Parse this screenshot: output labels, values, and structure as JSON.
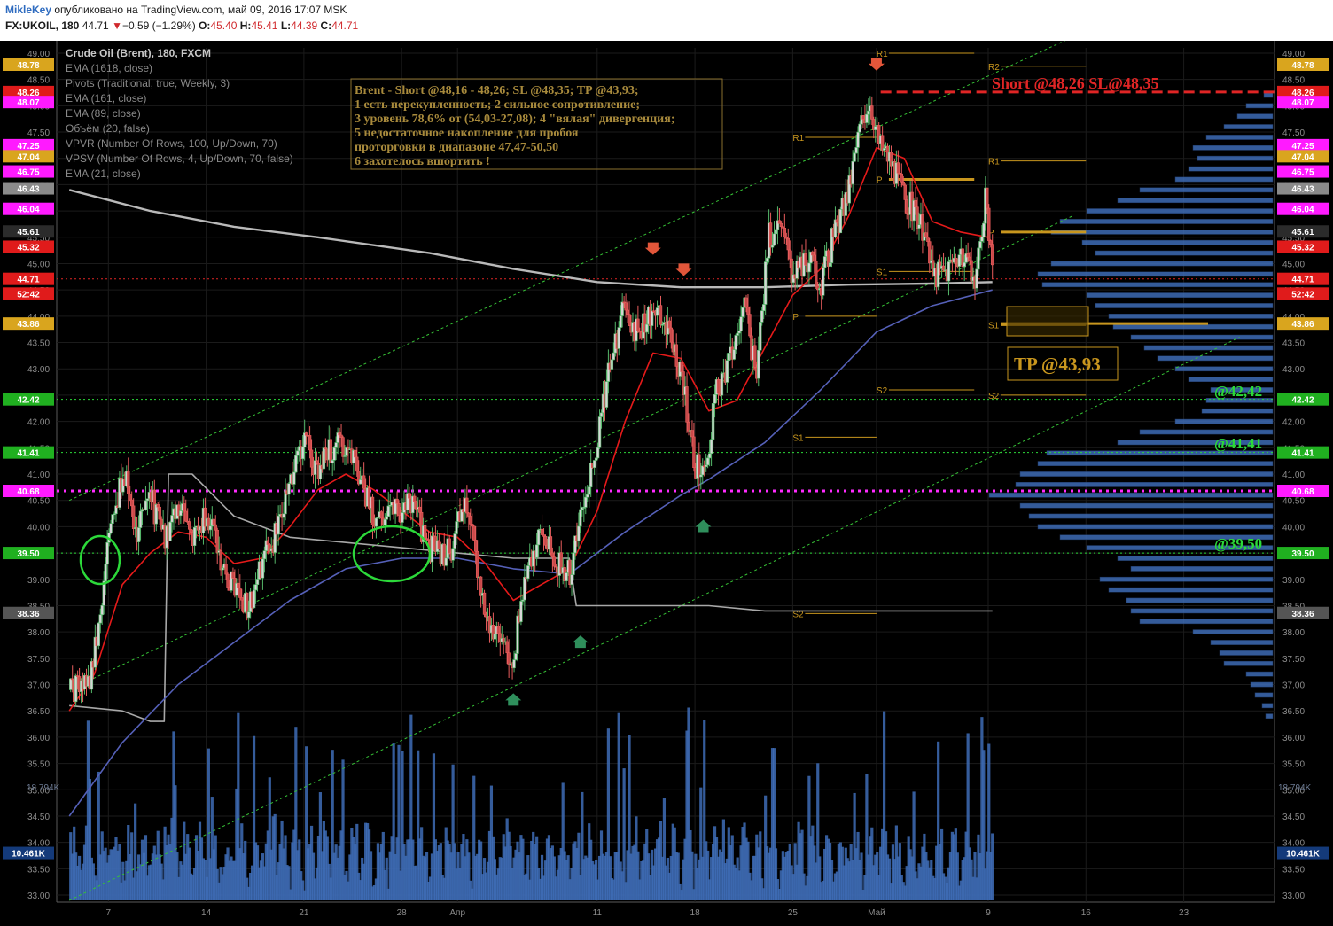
{
  "header": {
    "user": "MikleKey",
    "published": "опубликовано на TradingView.com, май 09, 2016 17:07 MSK",
    "symbol": "FX:UKOIL, 180",
    "last": "44.71",
    "arrow": "▼",
    "change": "−0.59 (−1.29%)",
    "o_label": "O:",
    "o": "45.40",
    "h_label": "H:",
    "h": "45.41",
    "l_label": "L:",
    "l": "44.39",
    "c_label": "C:",
    "c": "44.71"
  },
  "colors": {
    "bg": "#000000",
    "grid": "#1b1b1b",
    "axis_text": "#8c8c8c",
    "up": "#55b86a",
    "down": "#e85d5d",
    "ema21": "#e51a1a",
    "ema89": "#5560b8",
    "ema161": "#a8a8a8",
    "pivot": "#c8961e",
    "magenta": "#ff2bff",
    "green_note": "#2cd93a",
    "volume": "#3e6cb6",
    "note": "#a88a3c",
    "short": "#e02525"
  },
  "legend": [
    "Crude Oil (Brent), 180, FXCM",
    "EMA (1618, close)",
    "Pivots (Traditional, true, Weekly, 3)",
    "EMA (161, close)",
    "EMA (89, close)",
    "Объём (20, false)",
    "VPVR (Number Of Rows, 100, Up/Down, 70)",
    "VPSV (Number Of Rows, 4, Up/Down, 70, false)",
    "EMA (21, close)"
  ],
  "note": {
    "lines": [
      "Brent - Short @48,16 - 48,26; SL @48,35; TP @43,93;",
      "1 есть перекупленность; 2 сильное сопротивление;",
      "3 уровень 78,6% от (54,03-27,08); 4 \"вялая\" дивергенция;",
      "5 недостаточное накопление для пробоя",
      "проторговки в диапазоне 47,47-50,50",
      "6 захотелось вшортить !"
    ]
  },
  "annotations": {
    "short": "Short @48,26 SL@48,35",
    "tp": "TP @43,93",
    "lvl1": "@42,42",
    "lvl2": "@41,41",
    "lvl3": "@39,50"
  },
  "chart_data": {
    "type": "candlestick",
    "symbol": "FX:UKOIL",
    "title": "Crude Oil (Brent), 180, FXCM",
    "ylim": [
      32.9,
      49.1
    ],
    "y_ticks": [
      "49.00",
      "48.50",
      "48.00",
      "47.50",
      "47.00",
      "46.50",
      "46.00",
      "45.50",
      "45.00",
      "44.50",
      "44.00",
      "43.50",
      "43.00",
      "42.50",
      "42.00",
      "41.50",
      "41.00",
      "40.50",
      "40.00",
      "39.50",
      "39.00",
      "38.50",
      "38.00",
      "37.50",
      "37.00",
      "36.50",
      "36.00",
      "35.50",
      "35.00",
      "34.50",
      "34.00",
      "33.50",
      "33.00"
    ],
    "x_ticks": [
      {
        "label": "7",
        "day": 7
      },
      {
        "label": "14",
        "day": 14
      },
      {
        "label": "21",
        "day": 21
      },
      {
        "label": "28",
        "day": 28
      },
      {
        "label": "Апр",
        "day": 32
      },
      {
        "label": "11",
        "day": 42
      },
      {
        "label": "18",
        "day": 49
      },
      {
        "label": "25",
        "day": 56
      },
      {
        "label": "Май",
        "day": 62
      },
      {
        "label": "9",
        "day": 70
      },
      {
        "label": "16",
        "day": 77
      },
      {
        "label": "23",
        "day": 84
      }
    ],
    "price_path": [
      [
        4.2,
        36.9
      ],
      [
        5.5,
        36.9
      ],
      [
        6.5,
        38.4
      ],
      [
        7.2,
        40.4
      ],
      [
        8.3,
        40.9
      ],
      [
        9.0,
        39.8
      ],
      [
        10.0,
        40.6
      ],
      [
        11.0,
        39.7
      ],
      [
        12.0,
        40.3
      ],
      [
        13.0,
        39.9
      ],
      [
        14.2,
        40.2
      ],
      [
        15.0,
        39.4
      ],
      [
        16.0,
        38.8
      ],
      [
        17.0,
        38.4
      ],
      [
        18.0,
        39.3
      ],
      [
        19.0,
        39.9
      ],
      [
        20.0,
        40.7
      ],
      [
        21.0,
        41.7
      ],
      [
        21.8,
        41.1
      ],
      [
        22.8,
        41.4
      ],
      [
        23.8,
        41.6
      ],
      [
        24.8,
        41.2
      ],
      [
        25.8,
        40.3
      ],
      [
        26.8,
        40.1
      ],
      [
        27.8,
        40.3
      ],
      [
        28.8,
        40.5
      ],
      [
        29.8,
        39.6
      ],
      [
        30.8,
        39.5
      ],
      [
        31.8,
        39.6
      ],
      [
        32.3,
        40.6
      ],
      [
        33.0,
        39.9
      ],
      [
        34.0,
        38.4
      ],
      [
        35.0,
        37.7
      ],
      [
        36.0,
        37.5
      ],
      [
        37.0,
        39.3
      ],
      [
        38.0,
        40.0
      ],
      [
        39.0,
        39.3
      ],
      [
        40.0,
        39.1
      ],
      [
        41.0,
        40.3
      ],
      [
        42.0,
        41.6
      ],
      [
        43.0,
        43.2
      ],
      [
        44.0,
        44.2
      ],
      [
        45.0,
        43.6
      ],
      [
        46.0,
        44.2
      ],
      [
        47.0,
        43.7
      ],
      [
        48.0,
        42.9
      ],
      [
        49.0,
        41.2
      ],
      [
        49.8,
        40.9
      ],
      [
        50.4,
        42.5
      ],
      [
        51.5,
        43.2
      ],
      [
        52.5,
        44.2
      ],
      [
        53.4,
        42.9
      ],
      [
        54.3,
        45.5
      ],
      [
        55.2,
        45.9
      ],
      [
        56.0,
        44.7
      ],
      [
        57.0,
        45.1
      ],
      [
        58.0,
        44.6
      ],
      [
        59.0,
        45.6
      ],
      [
        60.0,
        46.4
      ],
      [
        60.8,
        47.6
      ],
      [
        61.5,
        48.2
      ],
      [
        62.2,
        47.3
      ],
      [
        63.0,
        47.0
      ],
      [
        64.0,
        46.3
      ],
      [
        65.0,
        45.9
      ],
      [
        66.0,
        44.8
      ],
      [
        67.0,
        44.9
      ],
      [
        68.0,
        45.3
      ],
      [
        69.0,
        44.6
      ],
      [
        69.8,
        46.2
      ],
      [
        70.3,
        44.8
      ]
    ],
    "ema21": [
      [
        4.2,
        36.5
      ],
      [
        6.0,
        37.2
      ],
      [
        8.0,
        38.9
      ],
      [
        10.0,
        39.5
      ],
      [
        12.0,
        39.9
      ],
      [
        14.0,
        39.8
      ],
      [
        16.0,
        39.3
      ],
      [
        18.0,
        39.4
      ],
      [
        20.0,
        40.0
      ],
      [
        22.0,
        40.7
      ],
      [
        24.0,
        41.0
      ],
      [
        26.0,
        40.7
      ],
      [
        28.0,
        40.3
      ],
      [
        30.0,
        39.9
      ],
      [
        32.0,
        39.8
      ],
      [
        34.0,
        39.3
      ],
      [
        36.0,
        38.6
      ],
      [
        38.0,
        38.9
      ],
      [
        40.0,
        39.2
      ],
      [
        42.0,
        40.3
      ],
      [
        44.0,
        42.0
      ],
      [
        46.0,
        43.3
      ],
      [
        48.0,
        43.2
      ],
      [
        50.0,
        42.2
      ],
      [
        52.0,
        42.4
      ],
      [
        54.0,
        43.4
      ],
      [
        56.0,
        44.4
      ],
      [
        58.0,
        44.9
      ],
      [
        60.0,
        45.9
      ],
      [
        62.0,
        47.2
      ],
      [
        64.0,
        47.0
      ],
      [
        66.0,
        45.8
      ],
      [
        68.0,
        45.6
      ],
      [
        70.0,
        45.5
      ],
      [
        70.3,
        45.4
      ]
    ],
    "ema89": [
      [
        4.2,
        34.5
      ],
      [
        8.0,
        35.9
      ],
      [
        12.0,
        37.0
      ],
      [
        16.0,
        37.8
      ],
      [
        20.0,
        38.6
      ],
      [
        24.0,
        39.2
      ],
      [
        28.0,
        39.4
      ],
      [
        32.0,
        39.4
      ],
      [
        36.0,
        39.2
      ],
      [
        40.0,
        39.1
      ],
      [
        44.0,
        39.9
      ],
      [
        48.0,
        40.6
      ],
      [
        50.0,
        40.9
      ],
      [
        54.0,
        41.6
      ],
      [
        58.0,
        42.6
      ],
      [
        62.0,
        43.7
      ],
      [
        66.0,
        44.2
      ],
      [
        70.3,
        44.5
      ]
    ],
    "ema1618": [
      [
        4.2,
        46.4
      ],
      [
        10.0,
        46.0
      ],
      [
        16.0,
        45.7
      ],
      [
        22.0,
        45.5
      ],
      [
        30.0,
        45.2
      ],
      [
        36.0,
        44.9
      ],
      [
        42.0,
        44.65
      ],
      [
        48.0,
        44.55
      ],
      [
        54.0,
        44.55
      ],
      [
        60.0,
        44.6
      ],
      [
        66.0,
        44.62
      ],
      [
        70.3,
        44.65
      ]
    ],
    "ema161": [
      [
        4.2,
        36.6
      ],
      [
        8.0,
        36.5
      ],
      [
        10.0,
        36.3
      ],
      [
        11.0,
        36.3
      ],
      [
        11.3,
        41.0
      ],
      [
        13.0,
        41.0
      ],
      [
        16.0,
        40.2
      ],
      [
        20.0,
        39.8
      ],
      [
        24.0,
        39.7
      ],
      [
        28.0,
        39.6
      ],
      [
        32.0,
        39.5
      ],
      [
        36.0,
        39.4
      ],
      [
        40.0,
        39.4
      ],
      [
        40.5,
        38.5
      ],
      [
        46.0,
        38.5
      ],
      [
        50.0,
        38.5
      ],
      [
        54.0,
        38.4
      ],
      [
        58.0,
        38.4
      ],
      [
        62.0,
        38.4
      ],
      [
        66.0,
        38.4
      ],
      [
        70.3,
        38.4
      ]
    ],
    "pivots": [
      {
        "label": "R1",
        "start": 62,
        "end": 69,
        "price": 49.0
      },
      {
        "label": "R2",
        "start": 70,
        "end": 77,
        "price": 48.75
      },
      {
        "label": "R1",
        "start": 56,
        "end": 62,
        "price": 47.4
      },
      {
        "label": "R1",
        "start": 70,
        "end": 77,
        "price": 46.95
      },
      {
        "label": "P",
        "start": 62,
        "end": 69,
        "price": 46.6
      },
      {
        "label": "P",
        "start": 70,
        "end": 77,
        "price": 45.6
      },
      {
        "label": "S1",
        "start": 62,
        "end": 69,
        "price": 44.85
      },
      {
        "label": "P",
        "start": 56,
        "end": 62,
        "price": 44.0
      },
      {
        "label": "S1",
        "start": 70,
        "end": 77,
        "price": 43.84
      },
      {
        "label": "S2",
        "start": 62,
        "end": 69,
        "price": 42.6
      },
      {
        "label": "S2",
        "start": 70,
        "end": 77,
        "price": 42.5
      },
      {
        "label": "S1",
        "start": 56,
        "end": 62,
        "price": 41.7
      },
      {
        "label": "S2",
        "start": 56,
        "end": 62,
        "price": 38.35
      }
    ],
    "price_labels": [
      {
        "price": 48.78,
        "text": "48.78",
        "color": "#d9a51e"
      },
      {
        "price": 48.26,
        "text": "48.26",
        "color": "#e01b1b"
      },
      {
        "price": 48.07,
        "text": "48.07",
        "color": "#ff1aff"
      },
      {
        "price": 47.25,
        "text": "47.25",
        "color": "#ff1aff"
      },
      {
        "price": 47.04,
        "text": "47.04",
        "color": "#d9a51e"
      },
      {
        "price": 46.75,
        "text": "46.75",
        "color": "#ff1aff"
      },
      {
        "price": 46.43,
        "text": "46.43",
        "color": "#8a8a8a"
      },
      {
        "price": 46.04,
        "text": "46.04",
        "color": "#ff1aff"
      },
      {
        "price": 45.61,
        "text": "45.61",
        "color": "#2b2b2b"
      },
      {
        "price": 45.32,
        "text": "45.32",
        "color": "#e01b1b"
      },
      {
        "price": 44.71,
        "text": "44.71",
        "color": "#e01b1b"
      },
      {
        "price": 44.43,
        "text": "52:42",
        "color": "#e01b1b"
      },
      {
        "price": 43.86,
        "text": "43.86",
        "color": "#d9a51e"
      },
      {
        "price": 42.42,
        "text": "42.42",
        "color": "#20b020"
      },
      {
        "price": 41.41,
        "text": "41.41",
        "color": "#20b020"
      },
      {
        "price": 40.68,
        "text": "40.68",
        "color": "#ff1aff"
      },
      {
        "price": 39.5,
        "text": "39.50",
        "color": "#20b020"
      },
      {
        "price": 38.36,
        "text": "38.36",
        "color": "#555555"
      },
      {
        "price": 33.8,
        "text": "10.461K",
        "color": "#143a7a"
      }
    ],
    "volume_axis_label": "18.794K",
    "volume_ref_label": "10.461K",
    "volume_profile": [
      [
        48.2,
        10
      ],
      [
        48.0,
        30
      ],
      [
        47.8,
        40
      ],
      [
        47.6,
        55
      ],
      [
        47.4,
        75
      ],
      [
        47.2,
        90
      ],
      [
        47.0,
        85
      ],
      [
        46.8,
        95
      ],
      [
        46.6,
        110
      ],
      [
        46.4,
        150
      ],
      [
        46.2,
        175
      ],
      [
        46.0,
        210
      ],
      [
        45.8,
        240
      ],
      [
        45.6,
        250
      ],
      [
        45.4,
        215
      ],
      [
        45.2,
        200
      ],
      [
        45.0,
        250
      ],
      [
        44.8,
        265
      ],
      [
        44.6,
        260
      ],
      [
        44.4,
        210
      ],
      [
        44.2,
        200
      ],
      [
        44.0,
        185
      ],
      [
        43.8,
        180
      ],
      [
        43.6,
        160
      ],
      [
        43.4,
        145
      ],
      [
        43.2,
        130
      ],
      [
        43.0,
        110
      ],
      [
        42.8,
        95
      ],
      [
        42.6,
        70
      ],
      [
        42.4,
        75
      ],
      [
        42.2,
        80
      ],
      [
        42.0,
        110
      ],
      [
        41.8,
        150
      ],
      [
        41.6,
        175
      ],
      [
        41.4,
        255
      ],
      [
        41.2,
        265
      ],
      [
        41.0,
        285
      ],
      [
        40.8,
        290
      ],
      [
        40.6,
        320
      ],
      [
        40.4,
        285
      ],
      [
        40.2,
        275
      ],
      [
        40.0,
        265
      ],
      [
        39.8,
        240
      ],
      [
        39.6,
        210
      ],
      [
        39.4,
        175
      ],
      [
        39.2,
        160
      ],
      [
        39.0,
        195
      ],
      [
        38.8,
        185
      ],
      [
        38.6,
        165
      ],
      [
        38.4,
        160
      ],
      [
        38.2,
        150
      ],
      [
        38.0,
        90
      ],
      [
        37.8,
        70
      ],
      [
        37.6,
        60
      ],
      [
        37.4,
        55
      ],
      [
        37.2,
        30
      ],
      [
        37.0,
        25
      ],
      [
        36.8,
        20
      ],
      [
        36.6,
        12
      ],
      [
        36.4,
        8
      ]
    ],
    "channel_lines": [
      {
        "from": [
          4.2,
          40.5
        ],
        "to": [
          76.0,
          49.3
        ]
      },
      {
        "from": [
          4.2,
          36.9
        ],
        "to": [
          76.0,
          45.9
        ]
      },
      {
        "from": [
          4.2,
          32.9
        ],
        "to": [
          88.0,
          43.6
        ]
      }
    ],
    "horizontal_levels": [
      {
        "price": 44.71,
        "style": "dotted",
        "color": "#e02525"
      },
      {
        "price": 40.68,
        "style": "dotted-thick",
        "color": "#ff2bff"
      },
      {
        "price": 39.5,
        "style": "dotted",
        "color": "#2cd93a"
      },
      {
        "price": 42.42,
        "style": "dotted",
        "color": "#2cd93a"
      },
      {
        "price": 41.41,
        "style": "dotted",
        "color": "#2cd93a"
      },
      {
        "price": 48.26,
        "style": "dashed",
        "color": "#e02525"
      }
    ]
  }
}
